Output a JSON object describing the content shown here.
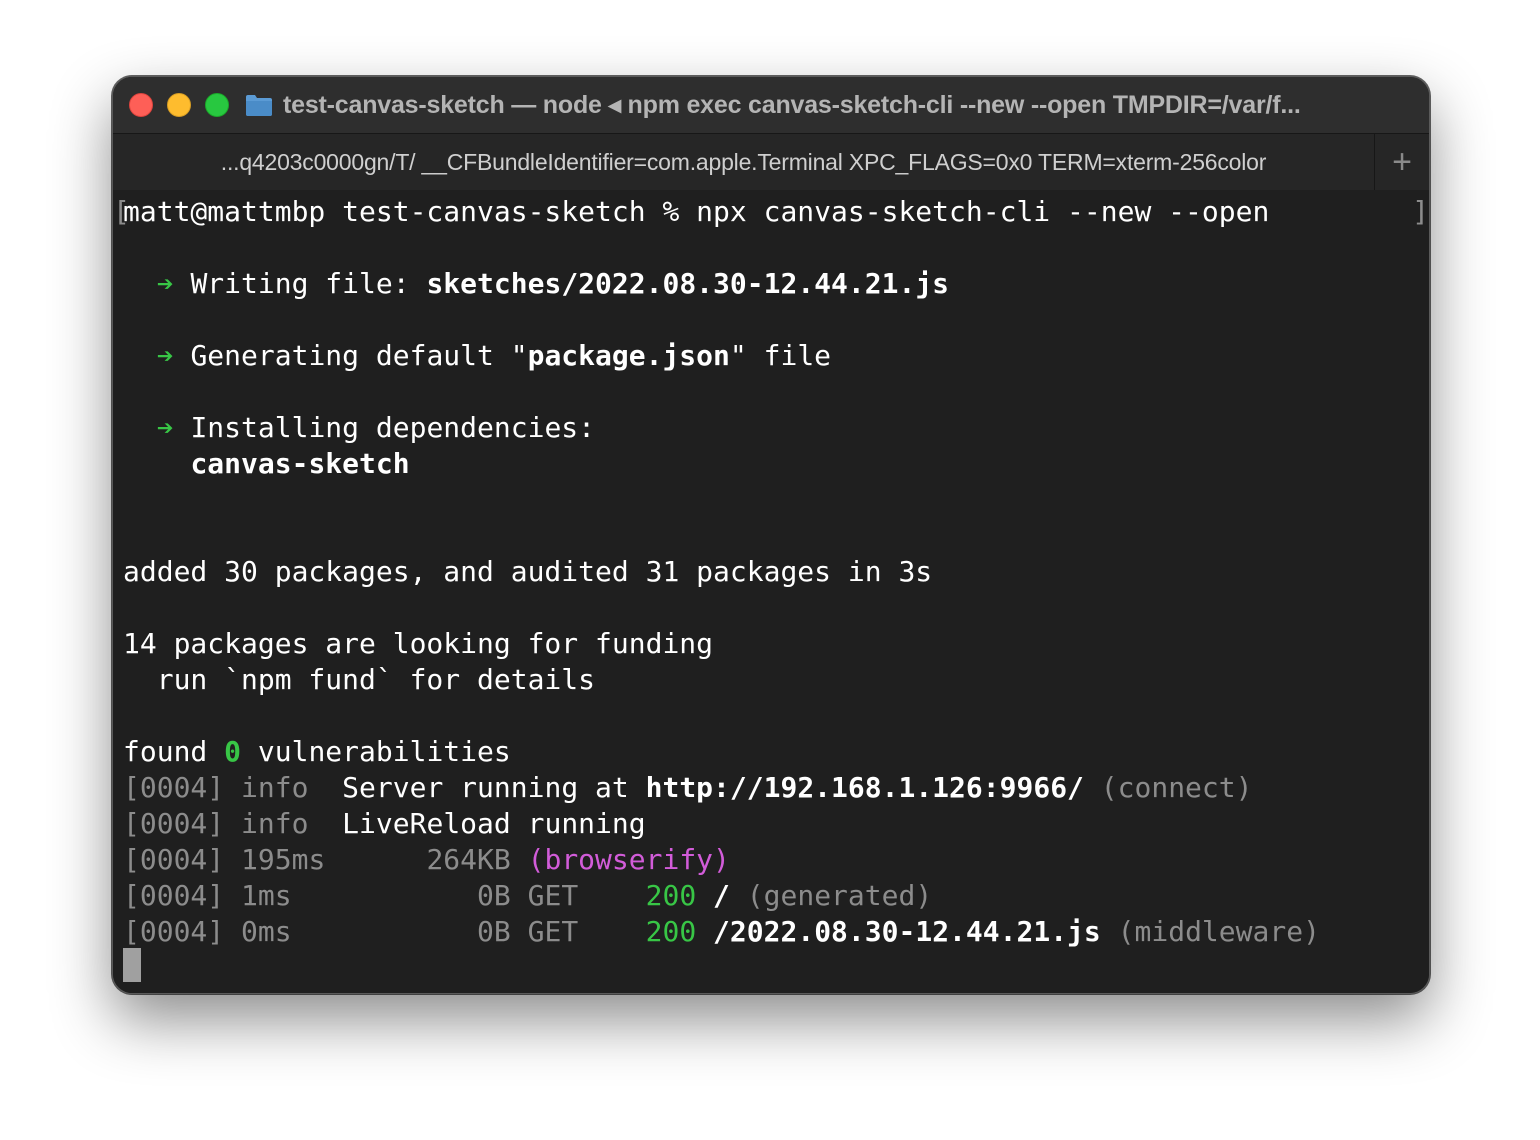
{
  "window": {
    "title": "test-canvas-sketch — node ◂ npm exec canvas-sketch-cli --new --open TMPDIR=/var/f...",
    "tab_label": "...q4203c0000gn/T/ __CFBundleIdentifier=com.apple.Terminal XPC_FLAGS=0x0 TERM=xterm-256color",
    "new_tab_label": "+"
  },
  "colors": {
    "accent_green": "#38c646",
    "magenta": "#d25cd9",
    "dim": "#8c8c8c",
    "background": "#1f1f1f"
  },
  "terminal": {
    "prompt": "matt@mattmbp test-canvas-sketch % npx canvas-sketch-cli --new --open",
    "arrow": "➔",
    "step1_label": "Writing file: ",
    "step1_value": "sketches/2022.08.30-12.44.21.js",
    "step2_label": "Generating default \"",
    "step2_value": "package.json",
    "step2_suffix": "\" file",
    "step3_label": "Installing dependencies:",
    "step3_value": "canvas-sketch",
    "added": "added 30 packages, and audited 31 packages in 3s",
    "funding": "14 packages are looking for funding",
    "fund_hint": "  run `npm fund` for details",
    "found_prefix": "found ",
    "found_count": "0",
    "found_suffix": " vulnerabilities",
    "log": [
      {
        "tag": "[0004] ",
        "level": "info  ",
        "text": "Server running at ",
        "url": "http://192.168.1.126:9966/",
        "note": " (connect)"
      },
      {
        "tag": "[0004] ",
        "level": "info  ",
        "text": "LiveReload running"
      },
      {
        "tag": "[0004] ",
        "time": "195ms      ",
        "size": "264KB ",
        "tool": "(browserify)"
      },
      {
        "tag": "[0004] ",
        "time": "1ms           ",
        "size": "0B GET    ",
        "status": "200 ",
        "path": "/",
        "note": " (generated)"
      },
      {
        "tag": "[0004] ",
        "time": "0ms           ",
        "size": "0B GET    ",
        "status": "200 ",
        "path": "/2022.08.30-12.44.21.js",
        "note": " (middleware)"
      }
    ]
  }
}
